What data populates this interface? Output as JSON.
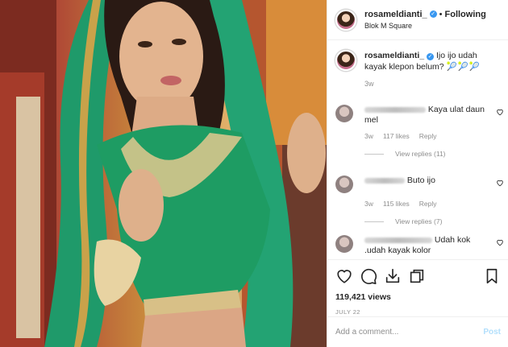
{
  "post": {
    "username": "rosameldianti_",
    "verified_glyph": "✓",
    "separator": "•",
    "follow_status": "Following",
    "location": "Blok M Square",
    "caption": {
      "username": "rosameldianti_",
      "text": "Ijo ijo udah kayak klepon belum?",
      "emojis": "🎾🎾🎾",
      "age": "3w"
    },
    "comments": [
      {
        "text": "Kaya ulat daun mel",
        "age": "3w",
        "likes": "117 likes",
        "reply_label": "Reply",
        "view_replies": "View replies (11)"
      },
      {
        "text": "Buto ijo",
        "age": "3w",
        "likes": "115 likes",
        "reply_label": "Reply",
        "view_replies": "View replies (7)"
      },
      {
        "text": "Udah kok .udah kayak kolor"
      }
    ],
    "views": "119,421 views",
    "date": "JULY 22",
    "add_comment_placeholder": "Add a comment...",
    "post_button": "Post"
  },
  "icons": {
    "like": "heart-icon",
    "comment": "comment-icon",
    "share": "share-icon",
    "save": "bookmark-icon",
    "comment_like": "heart-icon"
  },
  "colors": {
    "verified": "#3897f0",
    "muted": "#8e8e8e",
    "post_button": "#b2dffc",
    "scarf": "#1f9a6a"
  }
}
